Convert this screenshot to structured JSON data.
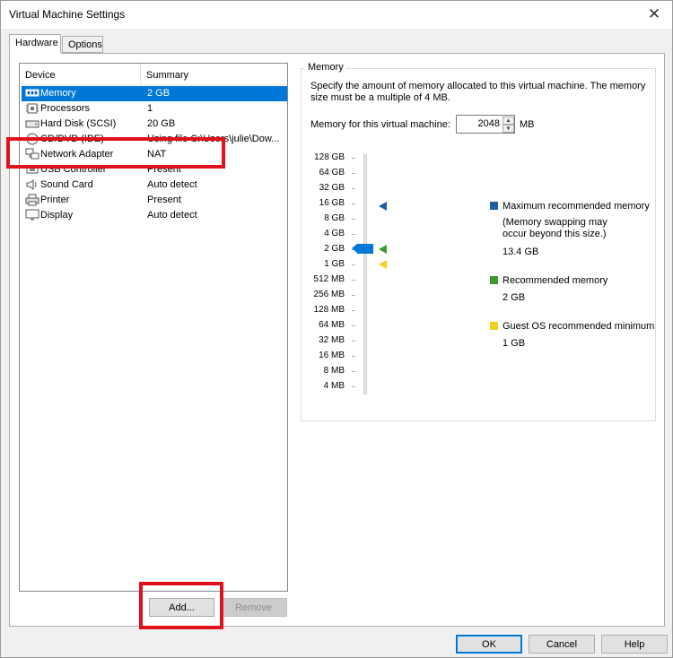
{
  "window": {
    "title": "Virtual Machine Settings",
    "close_glyph": "✕"
  },
  "tabs": [
    {
      "label": "Hardware"
    },
    {
      "label": "Options"
    }
  ],
  "device_list": {
    "columns": {
      "device": "Device",
      "summary": "Summary"
    },
    "rows": [
      {
        "device": "Memory",
        "summary": "2 GB",
        "icon": "memory-icon",
        "selected": true
      },
      {
        "device": "Processors",
        "summary": "1",
        "icon": "processor-icon"
      },
      {
        "device": "Hard Disk (SCSI)",
        "summary": "20 GB",
        "icon": "hard-disk-icon"
      },
      {
        "device": "CD/DVD (IDE)",
        "summary": "Using file C:\\Users\\julie\\Dow...",
        "icon": "cd-dvd-icon"
      },
      {
        "device": "Network Adapter",
        "summary": "NAT",
        "icon": "network-adapter-icon"
      },
      {
        "device": "USB Controller",
        "summary": "Present",
        "icon": "usb-icon"
      },
      {
        "device": "Sound Card",
        "summary": "Auto detect",
        "icon": "sound-icon"
      },
      {
        "device": "Printer",
        "summary": "Present",
        "icon": "printer-icon"
      },
      {
        "device": "Display",
        "summary": "Auto detect",
        "icon": "display-icon"
      }
    ],
    "add_label": "Add...",
    "remove_label": "Remove"
  },
  "memory": {
    "group_title": "Memory",
    "description": "Specify the amount of memory allocated to this virtual machine. The memory size must be a multiple of 4 MB.",
    "field_label": "Memory for this virtual machine:",
    "value": "2048",
    "unit": "MB",
    "scale": [
      "128 GB",
      "64 GB",
      "32 GB",
      "16 GB",
      "8 GB",
      "4 GB",
      "2 GB",
      "1 GB",
      "512 MB",
      "256 MB",
      "128 MB",
      "64 MB",
      "32 MB",
      "16 MB",
      "8 MB",
      "4 MB"
    ],
    "slider_level": "2 GB",
    "legend": {
      "max_label": "Maximum recommended memory",
      "max_note_1": "(Memory swapping may",
      "max_note_2": "occur beyond this size.)",
      "max_value": "13.4 GB",
      "rec_label": "Recommended memory",
      "rec_value": "2 GB",
      "min_label": "Guest OS recommended minimum",
      "min_value": "1 GB"
    },
    "colors": {
      "max": "#1f5fa0",
      "recommended": "#3d9a2c",
      "minimum": "#f0d020"
    }
  },
  "footer": {
    "ok": "OK",
    "cancel": "Cancel",
    "help": "Help"
  },
  "annotation_color": "#e0111c"
}
